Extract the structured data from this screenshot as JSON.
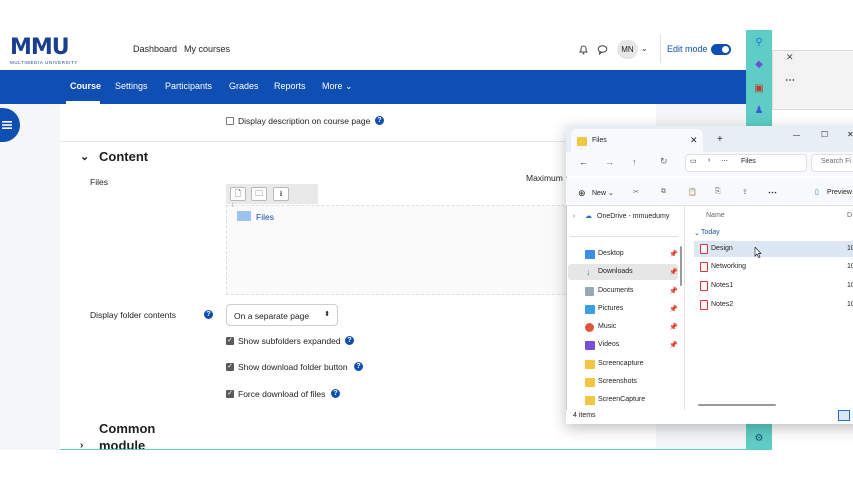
{
  "moodle": {
    "logo": {
      "main_left": "MMU",
      "tagline": "MULTIMEDIA UNIVERSITY"
    },
    "top_links": [
      "Dashboard",
      "My courses"
    ],
    "user_initials": "MN",
    "edit_mode_label": "Edit mode",
    "nav": {
      "course": "Course",
      "settings": "Settings",
      "participants": "Participants",
      "grades": "Grades",
      "reports": "Reports",
      "more": "More"
    },
    "display_description": "Display description on course page",
    "content_title": "Content",
    "files_label": "Files",
    "maximum_label": "Maximum",
    "filepicker_folder": "Files",
    "display_folder_label": "Display folder contents",
    "display_folder_value": "On a separate page",
    "show_subfolders": "Show subfolders expanded",
    "show_download": "Show download folder button",
    "force_download": "Force download of files",
    "common_module_line1": "Common",
    "common_module_line2": "module"
  },
  "explorer": {
    "tab_title": "Files",
    "address": "Files",
    "search_placeholder": "Search Fi",
    "new_label": "New",
    "preview_label": "Preview",
    "column_name": "Name",
    "column_d": "D",
    "group_today": "Today",
    "nav_items": [
      {
        "label": "OneDrive - mmuedumy"
      },
      {
        "label": "Desktop"
      },
      {
        "label": "Downloads"
      },
      {
        "label": "Documents"
      },
      {
        "label": "Pictures"
      },
      {
        "label": "Music"
      },
      {
        "label": "Videos"
      },
      {
        "label": "Screencapture"
      },
      {
        "label": "Screenshots"
      },
      {
        "label": "ScreenCapture"
      }
    ],
    "files": [
      {
        "name": "Design",
        "col": "10"
      },
      {
        "name": "Networking",
        "col": "10"
      },
      {
        "name": "Notes1",
        "col": "10"
      },
      {
        "name": "Notes2",
        "col": "10"
      }
    ],
    "status_count": "4 items"
  },
  "colors": {
    "moodle_blue": "#0f4fb3",
    "teal_strip": "#5fcdc5",
    "mmu_red": "#d42027"
  }
}
